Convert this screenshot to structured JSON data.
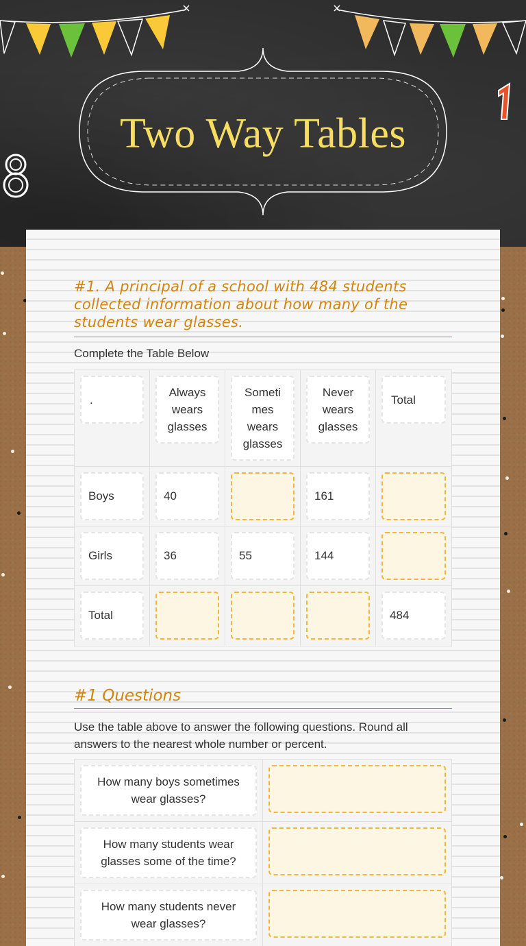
{
  "header": {
    "title": "Two Way Tables",
    "decorations": [
      "bunting-left",
      "bunting-right",
      "number-one-icon",
      "number-eight-icon"
    ],
    "colors": {
      "title": "#f7dd62",
      "chalkboard": "#2e2e2e",
      "flag_yellow": "#f9c938",
      "flag_green": "#6bc13a",
      "flag_orange": "#f1b85c",
      "one_red": "#e8532a"
    }
  },
  "section1": {
    "heading": "#1. A principal of a school with 484 students collected information about how many of the students wear glasses.",
    "instruction": "Complete the Table Below",
    "table": {
      "headers": [
        ".",
        "Always wears glasses",
        "Sometimes wears glasses",
        "Never wears glasses",
        "Total"
      ],
      "header_display": [
        ".",
        "Always wears glasses",
        "Someti mes wears glasses",
        "Never wears glasses",
        "Total"
      ],
      "rows": [
        {
          "label": "Boys",
          "values": [
            "40",
            "",
            "161",
            ""
          ]
        },
        {
          "label": "Girls",
          "values": [
            "36",
            "55",
            "144",
            ""
          ]
        },
        {
          "label": "Total",
          "values": [
            "",
            "",
            "",
            "484"
          ]
        }
      ]
    }
  },
  "section2": {
    "heading": "#1 Questions",
    "instruction": "Use the table above to answer the following questions. Round all answers to the nearest whole number or percent.",
    "questions": [
      {
        "question": "How many boys sometimes wear glasses?",
        "answer": ""
      },
      {
        "question": "How many students wear glasses some of the time?",
        "answer": ""
      },
      {
        "question": "How many students never wear glasses?",
        "answer": ""
      }
    ]
  },
  "accent_color": "#d1840f",
  "answer_border_color": "#f5b43a",
  "answer_fill_color": "#fdf6e3"
}
